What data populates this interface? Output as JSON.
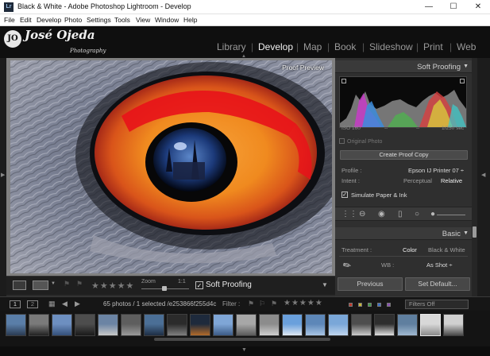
{
  "window": {
    "title": "Black & White - Adobe Photoshop Lightroom - Develop",
    "app_icon": "Lr",
    "controls": [
      "—",
      "☐",
      "✕"
    ]
  },
  "menu": [
    "File",
    "Edit",
    "Develop",
    "Photo",
    "Settings",
    "Tools",
    "View",
    "Window",
    "Help"
  ],
  "identity": {
    "monogram": "JO",
    "name": "José Ojeda",
    "subtitle": "Photography"
  },
  "modules": [
    {
      "label": "Library",
      "active": false
    },
    {
      "label": "Develop",
      "active": true
    },
    {
      "label": "Map",
      "active": false
    },
    {
      "label": "Book",
      "active": false
    },
    {
      "label": "Slideshow",
      "active": false
    },
    {
      "label": "Print",
      "active": false
    },
    {
      "label": "Web",
      "active": false
    }
  ],
  "photo": {
    "overlay_label": "Proof Preview"
  },
  "toolbar": {
    "stars": "★★★★★",
    "zoom_label": "Zoom",
    "zoom_ratio": "1:1",
    "soft_proofing_label": "Soft Proofing",
    "soft_proofing_checked": true
  },
  "soft_proofing_panel": {
    "title": "Soft Proofing",
    "histogram": {
      "iso": "ISO 160",
      "dash1": "--",
      "dash2": "--",
      "shutter": "1/250 sec"
    },
    "original_photo_label": "Original Photo",
    "create_proof_copy": "Create Proof Copy",
    "profile_label": "Profile :",
    "profile_value": "Epson IJ Printer 07 ÷",
    "intent_label": "Intent :",
    "intent_options": [
      "Perceptual",
      "Relative"
    ],
    "intent_selected": "Relative",
    "simulate_label": "Simulate Paper & Ink",
    "simulate_checked": true
  },
  "basic_panel": {
    "title": "Basic",
    "treatment_label": "Treatment :",
    "treatment_options": [
      "Color",
      "Black & White"
    ],
    "treatment_selected": "Color",
    "wb_label": "WB :",
    "wb_value": "As Shot ÷"
  },
  "bottom_buttons": {
    "previous": "Previous",
    "set_default": "Set Default..."
  },
  "filmstrip": {
    "monitor1": "1",
    "monitor2": "2",
    "info": "65 photos / 1 selected /e253866f255d4c",
    "filter_label": "Filter :",
    "stars": "★★★★★",
    "filter_value": "Filters Off",
    "thumb_count": 20,
    "selected_index": 18
  },
  "colors": {
    "accent_text": "#f2f2f2",
    "panel_bg": "#2f2f2f",
    "flag_red": "#c0392b",
    "flag_yellow": "#c9b634",
    "flag_green": "#3e9b4a",
    "flag_blue": "#3d6fc4",
    "flag_purple": "#8a52b3"
  }
}
